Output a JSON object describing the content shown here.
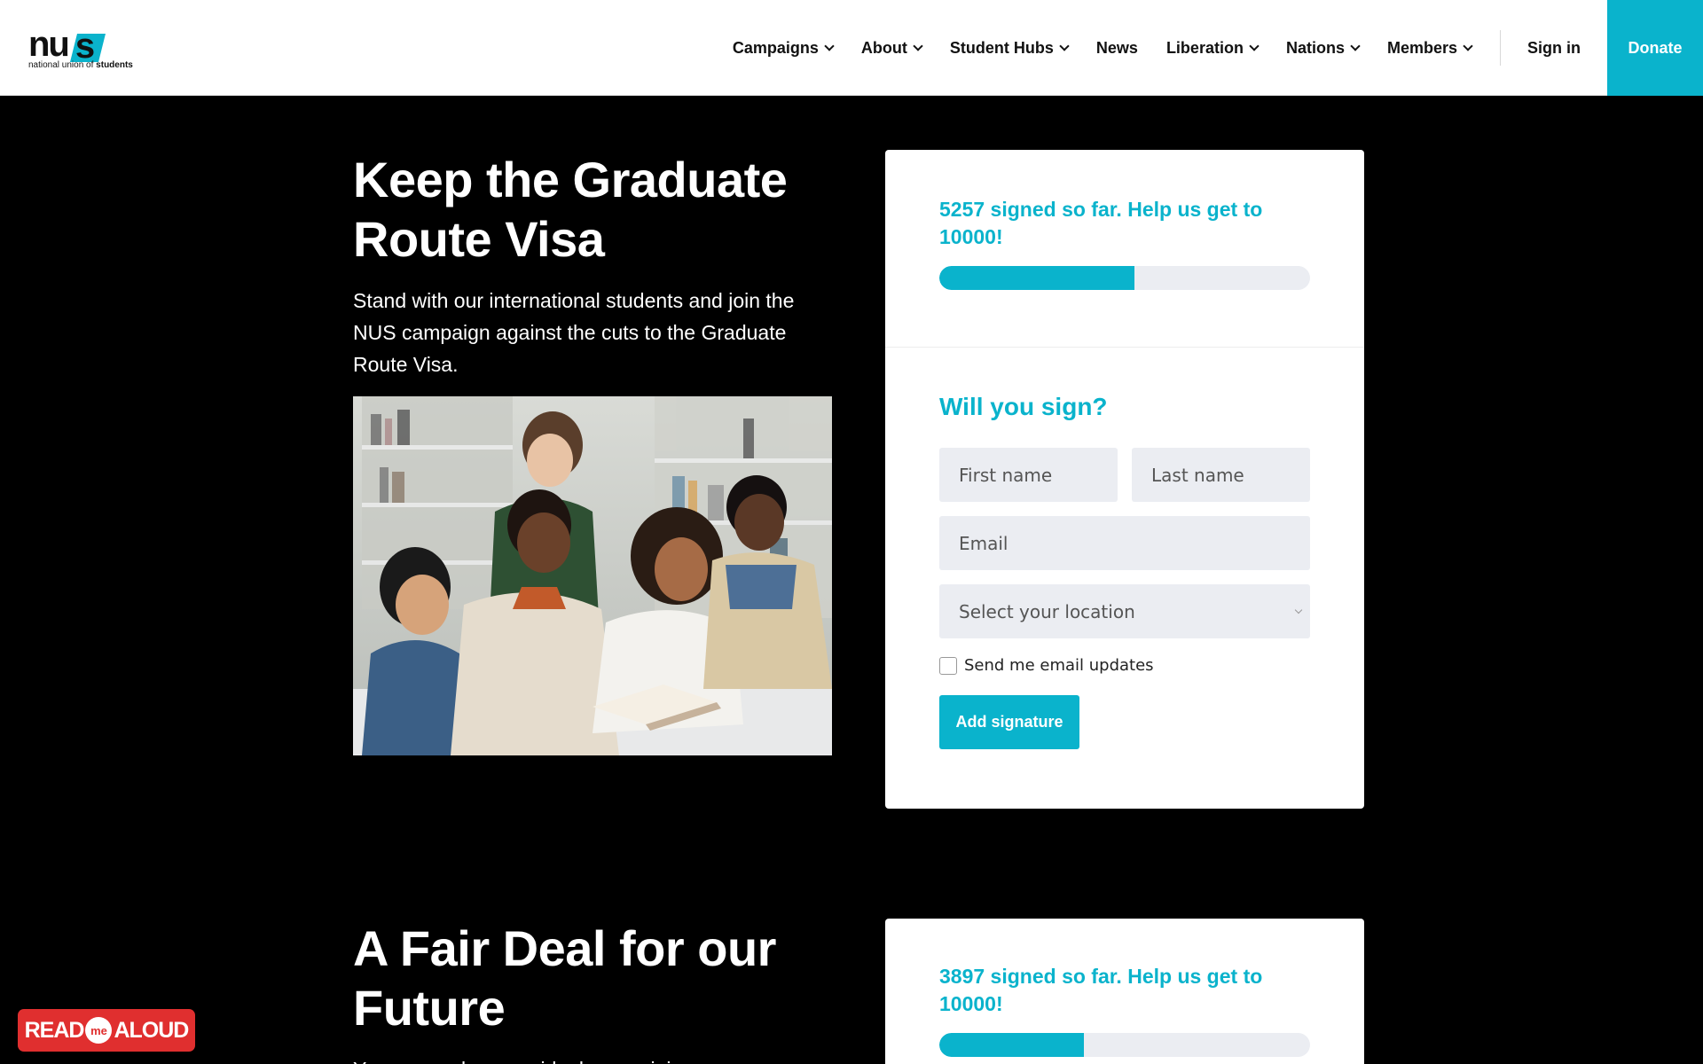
{
  "brand": {
    "logo_main": "nu",
    "logo_s": "s",
    "logo_sub_prefix": "national union of ",
    "logo_sub_bold": "students",
    "accent": "#0ab3cc"
  },
  "nav": {
    "items": [
      {
        "label": "Campaigns",
        "has_dropdown": true
      },
      {
        "label": "About",
        "has_dropdown": true
      },
      {
        "label": "Student Hubs",
        "has_dropdown": true
      },
      {
        "label": "News",
        "has_dropdown": false
      },
      {
        "label": "Liberation",
        "has_dropdown": true
      },
      {
        "label": "Nations",
        "has_dropdown": true
      },
      {
        "label": "Members",
        "has_dropdown": true
      }
    ],
    "signin": "Sign in",
    "donate": "Donate"
  },
  "campaigns": [
    {
      "title": "Keep the Graduate Route Visa",
      "description": "Stand with our international students and join the NUS campaign against the cuts to the Graduate Route Visa.",
      "signed_text": "5257 signed so far. Help us get to 10000!",
      "signed": 5257,
      "goal": 10000,
      "form": {
        "heading": "Will you sign?",
        "first_name_placeholder": "First name",
        "last_name_placeholder": "Last name",
        "email_placeholder": "Email",
        "location_placeholder": "Select your location",
        "email_updates_label": "Send me email updates",
        "submit_label": "Add signature"
      }
    },
    {
      "title": "A Fair Deal for our Future",
      "description": "Young people are paid a lower minimum wage",
      "signed_text": "3897 signed so far. Help us get to 10000!",
      "signed": 3897,
      "goal": 10000
    }
  ],
  "readaloud": {
    "read": "READ",
    "me": "me",
    "aloud": "ALOUD"
  }
}
